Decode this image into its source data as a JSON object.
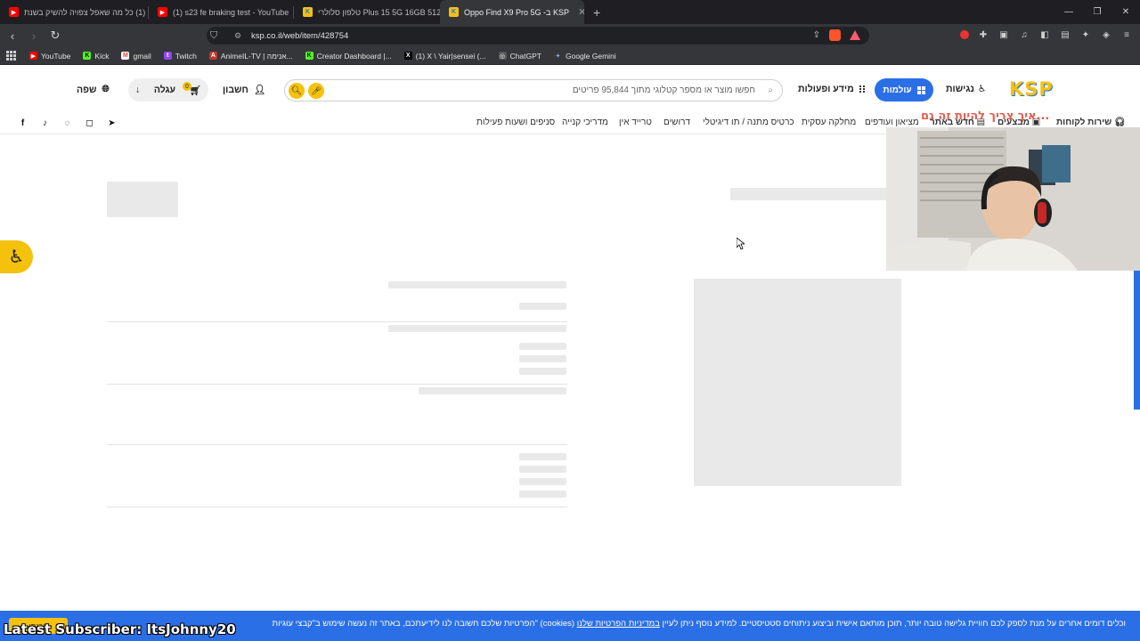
{
  "browser": {
    "tabs": [
      {
        "title": "(1) כל מה שאפל צפויה להשיק בשנת",
        "icon": "youtube-icon",
        "active": false
      },
      {
        "title": "(1) s23 fe braking test - YouTube",
        "icon": "youtube-icon",
        "active": false
      },
      {
        "title": "טלפון סלולרי Plus 15 5G 16GB 512GB",
        "icon": "ksp-icon",
        "active": false
      },
      {
        "title": "Oppo Find X9 Pro 5G -ב KSP",
        "icon": "ksp-icon",
        "active": true
      }
    ],
    "new_tab": "+",
    "url": "ksp.co.il/web/item/428754",
    "bookmarks": [
      {
        "label": "YouTube",
        "icon": "youtube-icon",
        "color": "#ff0000"
      },
      {
        "label": "Kick",
        "icon": "kick-icon",
        "color": "#53fc18"
      },
      {
        "label": "gmail",
        "icon": "gmail-icon",
        "color": "#ea4335"
      },
      {
        "label": "Twitch",
        "icon": "twitch-icon",
        "color": "#9146ff"
      },
      {
        "label": "AnimeIL-TV | אנימה...",
        "icon": "animeil-icon",
        "color": "#c0392b"
      },
      {
        "label": "Creator Dashboard |...",
        "icon": "kick-icon",
        "color": "#53fc18"
      },
      {
        "label": "(1) X \\ Yair|sensei (...",
        "icon": "x-icon",
        "color": "#000000"
      },
      {
        "label": "ChatGPT",
        "icon": "chatgpt-icon",
        "color": "#888888"
      },
      {
        "label": "Google Gemini",
        "icon": "gemini-icon",
        "color": "#4285f4"
      }
    ]
  },
  "header": {
    "accessibility": "נגישות",
    "categories": "עולמות",
    "info": "מידע ופעולות",
    "search_placeholder": "חפשו מוצר או מספר קטלוגי מתוך 95,844 פריטים",
    "account": "חשבון",
    "cart": "עגלה",
    "cart_count": "0",
    "language": "שפה"
  },
  "subnav": {
    "items": [
      {
        "label": "שירות לקוחות",
        "bold": true
      },
      {
        "label": "מבצעים",
        "bold": true
      },
      {
        "label": "חדש באתר",
        "bold": true
      },
      {
        "label": "מציאון ועודפים",
        "bold": false
      },
      {
        "label": "מחלקה עסקית",
        "bold": false
      },
      {
        "label": "כרטיס מתנה / תו דיגיטלי",
        "bold": false
      },
      {
        "label": "דרושים",
        "bold": false
      },
      {
        "label": "טרייד אין",
        "bold": false
      },
      {
        "label": "מדריכי קנייה",
        "bold": false
      },
      {
        "label": "סניפים ושעות פעילות",
        "bold": false
      }
    ]
  },
  "cookie": {
    "text": "הפרטיות שלכם חשובה לנו לידיעתכם, באתר זה נעשה שימוש ב\"קבצי עוגיות\" (cookies) וכלים דומים אחרים על מנת לספק לכם חוויית גלישה טובה יותר, תוכן מותאם אישית וביצוע ניתוחים סטטיסטיים. למידע נוסף ניתן לעיין",
    "link": "במדיניות הפרטיות שלנו",
    "ok": "הבנתי"
  },
  "overlay": {
    "latest_subscriber": "Latest Subscriber: ItsJohnny20",
    "stream_title": "איך צריך להיות זה גם..."
  },
  "colors": {
    "accent_blue": "#2a6fe6",
    "accent_yellow": "#f4c20d",
    "chrome_dark": "#35363a"
  }
}
